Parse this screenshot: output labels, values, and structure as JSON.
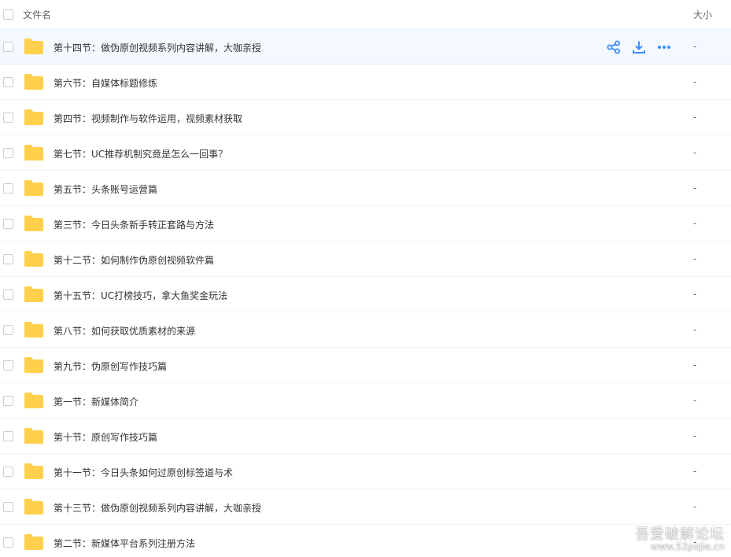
{
  "header": {
    "name_label": "文件名",
    "size_label": "大小"
  },
  "rows": [
    {
      "name": "第十四节：做伪原创视频系列内容讲解，大咖亲授",
      "size": "-"
    },
    {
      "name": "第六节：自媒体标题修炼",
      "size": "-"
    },
    {
      "name": "第四节：视频制作与软件运用，视频素材获取",
      "size": "-"
    },
    {
      "name": "第七节：UC推荐机制究竟是怎么一回事？",
      "size": "-"
    },
    {
      "name": "第五节：头条账号运营篇",
      "size": "-"
    },
    {
      "name": "第三节：今日头条新手转正套路与方法",
      "size": "-"
    },
    {
      "name": "第十二节：如何制作伪原创视频软件篇",
      "size": "-"
    },
    {
      "name": "第十五节：UC打榜技巧，拿大鱼奖金玩法",
      "size": "-"
    },
    {
      "name": "第八节：如何获取优质素材的来源",
      "size": "-"
    },
    {
      "name": "第九节：伪原创写作技巧篇",
      "size": "-"
    },
    {
      "name": "第一节：新媒体简介",
      "size": "-"
    },
    {
      "name": "第十节：原创写作技巧篇",
      "size": "-"
    },
    {
      "name": "第十一节：今日头条如何过原创标签道与术",
      "size": "-"
    },
    {
      "name": "第十三节：做伪原创视频系列内容讲解，大咖亲授",
      "size": "-"
    },
    {
      "name": "第二节：新媒体平台系列注册方法",
      "size": "-"
    }
  ],
  "hover_actions": [
    "share-icon",
    "download-icon",
    "more-icon"
  ],
  "colors": {
    "folder": "#ffd04b",
    "accent": "#3b8cff"
  },
  "watermark": {
    "line1": "吾爱破解论坛",
    "line2": "www.52pojie.cn"
  }
}
